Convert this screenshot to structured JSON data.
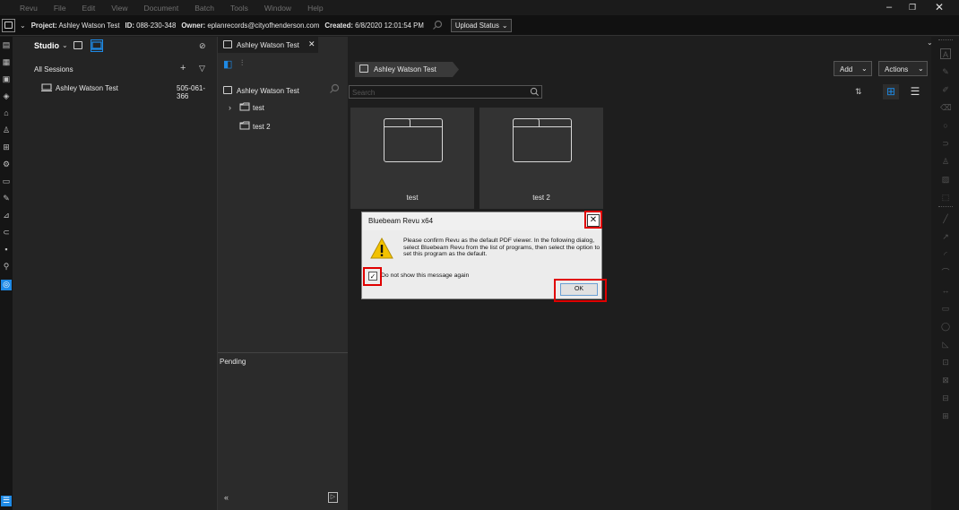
{
  "menubar": {
    "items": [
      "Revu",
      "File",
      "Edit",
      "View",
      "Document",
      "Batch",
      "Tools",
      "Window",
      "Help"
    ]
  },
  "project_bar": {
    "project_label": "Project:",
    "project_value": "Ashley Watson Test",
    "id_label": "ID:",
    "id_value": "088-230-348",
    "owner_label": "Owner:",
    "owner_value": "eplanrecords@cityofhenderson.com",
    "created_label": "Created:",
    "created_value": "6/8/2020 12:01:54 PM",
    "upload_status": "Upload Status"
  },
  "studio": {
    "title": "Studio",
    "all_sessions": "All Sessions",
    "session_name": "Ashley Watson Test",
    "session_id": "505-061-366"
  },
  "tab": {
    "label": "Ashley Watson Test"
  },
  "explorer": {
    "root": "Ashley Watson Test",
    "folders": [
      "test",
      "test 2"
    ],
    "pending": "Pending",
    "collapse": "«"
  },
  "main": {
    "breadcrumb": "Ashley Watson Test",
    "search_placeholder": "Search",
    "add_button": "Add",
    "actions_button": "Actions",
    "cards": [
      "test",
      "test 2"
    ]
  },
  "dialog": {
    "title": "Bluebeam Revu x64",
    "message": "Please confirm Revu as the default PDF viewer.  In the following dialog, select Bluebeam Revu from the list of programs, then select the option to set this program as the default.",
    "checkbox_label": "Do not show this message again",
    "checkbox_checked": true,
    "ok_button": "OK"
  },
  "colors": {
    "accent": "#1e8ae6",
    "highlight": "#e00000",
    "warning": "#f2c200"
  },
  "icons": {
    "warning": "warning-icon",
    "close": "close-icon"
  }
}
